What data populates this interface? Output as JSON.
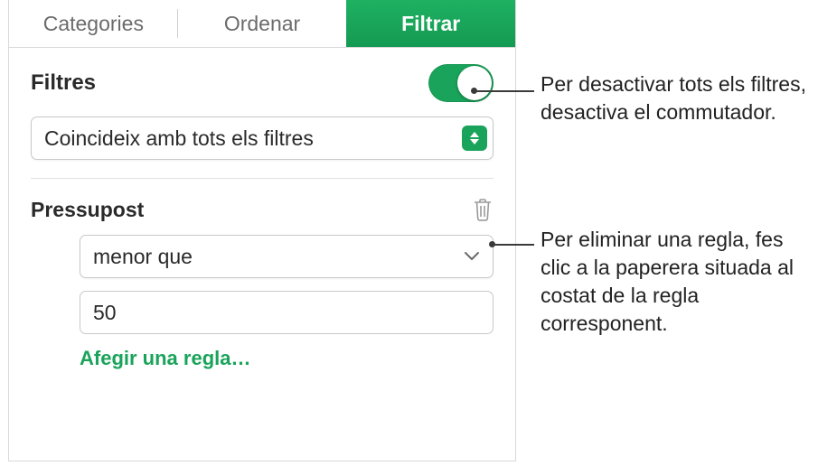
{
  "tabs": {
    "categories": "Categories",
    "sort": "Ordenar",
    "filter": "Filtrar"
  },
  "header": {
    "title": "Filtres"
  },
  "match": {
    "label": "Coincideix amb tots els filtres"
  },
  "rule": {
    "column": "Pressupost",
    "operator": "menor que",
    "value": "50",
    "add": "Afegir una regla…"
  },
  "callouts": {
    "toggle": "Per desactivar tots els filtres, desactiva el commutador.",
    "trash": "Per eliminar una regla, fes clic a la paperera situada al costat de la regla corresponent."
  }
}
